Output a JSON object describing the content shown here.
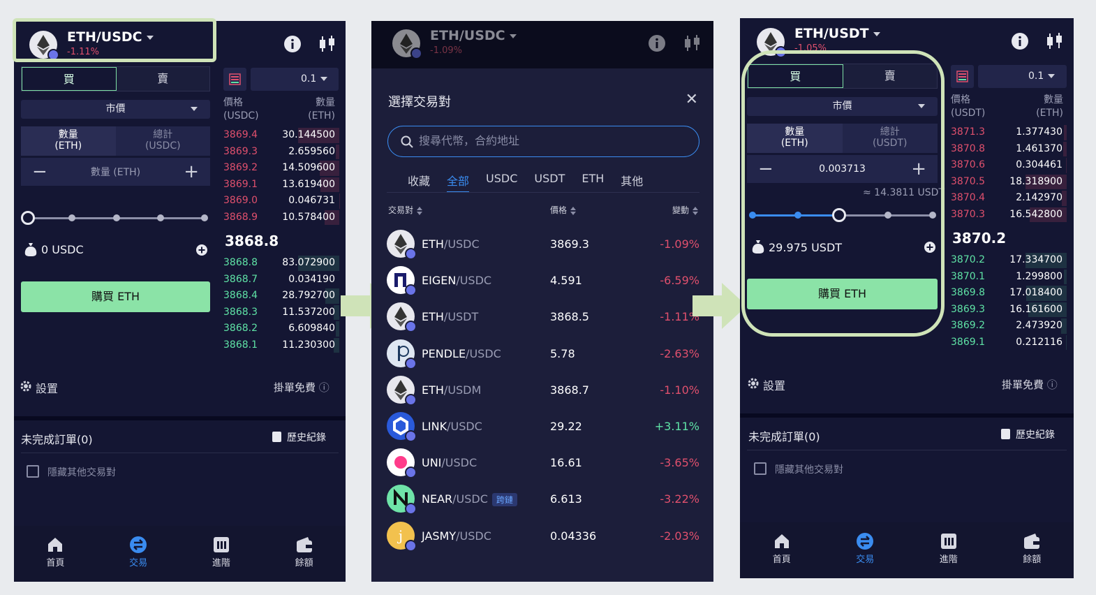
{
  "screen1": {
    "pair": "ETH/USDC",
    "change": "-1.11%",
    "tabs": [
      "買",
      "賣"
    ],
    "order_type": "市價",
    "toggle": [
      {
        "line1": "數量",
        "line2": "(ETH)"
      },
      {
        "line1": "總計",
        "line2": "(USDC)"
      }
    ],
    "qty_placeholder": "數量 (ETH)",
    "slider_fraction": 0,
    "balance": "0 USDC",
    "buy_label": "購買 ETH",
    "settings": "設置",
    "fee": "掛單免費",
    "orders_title": "未完成訂單(0)",
    "history": "歷史紀錄",
    "hide_other": "隱藏其他交易對",
    "orderbook": {
      "step": "0.1",
      "price_header": [
        "價格",
        "(USDC)"
      ],
      "amount_header": [
        "數量",
        "(ETH)"
      ],
      "asks": [
        {
          "price": "3869.4",
          "amount": "30.144500"
        },
        {
          "price": "3869.3",
          "amount": "2.659560"
        },
        {
          "price": "3869.2",
          "amount": "14.509600"
        },
        {
          "price": "3869.1",
          "amount": "13.619400"
        },
        {
          "price": "3869.0",
          "amount": "0.046731"
        },
        {
          "price": "3868.9",
          "amount": "10.578400"
        }
      ],
      "mid": "3868.8",
      "bids": [
        {
          "price": "3868.8",
          "amount": "83.072900"
        },
        {
          "price": "3868.7",
          "amount": "0.034190"
        },
        {
          "price": "3868.4",
          "amount": "28.792700"
        },
        {
          "price": "3868.3",
          "amount": "11.537200"
        },
        {
          "price": "3868.2",
          "amount": "6.609840"
        },
        {
          "price": "3868.1",
          "amount": "11.230300"
        }
      ]
    }
  },
  "screen2": {
    "pair": "ETH/USDC",
    "change": "-1.09%",
    "modal_title": "選擇交易對",
    "search_placeholder": "搜尋代幣，合約地址",
    "categories": [
      "收藏",
      "全部",
      "USDC",
      "USDT",
      "ETH",
      "其他"
    ],
    "active_category": "全部",
    "col_pair": "交易對",
    "col_price": "價格",
    "col_change": "變動",
    "rows": [
      {
        "base": "ETH",
        "quote": "/USDC",
        "price": "3869.3",
        "change": "-1.09%",
        "up": false,
        "coin_color": "#e8e8ee"
      },
      {
        "base": "EIGEN",
        "quote": "/USDC",
        "price": "4.591",
        "change": "-6.59%",
        "up": false,
        "coin_color": "#ffffff"
      },
      {
        "base": "ETH",
        "quote": "/USDT",
        "price": "3868.5",
        "change": "-1.11%",
        "up": false,
        "coin_color": "#e8e8ee"
      },
      {
        "base": "PENDLE",
        "quote": "/USDC",
        "price": "5.78",
        "change": "-2.63%",
        "up": false,
        "coin_color": "#dfe7f2"
      },
      {
        "base": "ETH",
        "quote": "/USDM",
        "price": "3868.7",
        "change": "-1.10%",
        "up": false,
        "coin_color": "#e8e8ee"
      },
      {
        "base": "LINK",
        "quote": "/USDC",
        "price": "29.22",
        "change": "+3.11%",
        "up": true,
        "coin_color": "#2a5ada"
      },
      {
        "base": "UNI",
        "quote": "/USDC",
        "price": "16.61",
        "change": "-3.65%",
        "up": false,
        "coin_color": "#ffffff"
      },
      {
        "base": "NEAR",
        "quote": "/USDC",
        "price": "6.613",
        "change": "-3.22%",
        "up": false,
        "coin_color": "#6fe3a8",
        "badge": "跨鏈"
      },
      {
        "base": "JASMY",
        "quote": "/USDC",
        "price": "0.04336",
        "change": "-2.03%",
        "up": false,
        "coin_color": "#f2c14e"
      }
    ]
  },
  "screen3": {
    "pair": "ETH/USDT",
    "change": "-1.05%",
    "tabs": [
      "買",
      "賣"
    ],
    "order_type": "市價",
    "toggle": [
      {
        "line1": "數量",
        "line2": "(ETH)"
      },
      {
        "line1": "總計",
        "line2": "(USDT)"
      }
    ],
    "qty_value": "0.003713",
    "estimate": "≈ 14.3811 USDT",
    "slider_fraction": 0.48,
    "balance": "29.975 USDT",
    "buy_label": "購買 ETH",
    "settings": "設置",
    "fee": "掛單免費",
    "orders_title": "未完成訂單(0)",
    "history": "歷史紀錄",
    "hide_other": "隱藏其他交易對",
    "orderbook": {
      "step": "0.1",
      "price_header": [
        "價格",
        "(USDT)"
      ],
      "amount_header": [
        "數量",
        "(ETH)"
      ],
      "asks": [
        {
          "price": "3871.3",
          "amount": "1.377430"
        },
        {
          "price": "3870.8",
          "amount": "1.461370"
        },
        {
          "price": "3870.6",
          "amount": "0.304461"
        },
        {
          "price": "3870.5",
          "amount": "18.318900"
        },
        {
          "price": "3870.4",
          "amount": "2.142970"
        },
        {
          "price": "3870.3",
          "amount": "16.542800"
        }
      ],
      "mid": "3870.2",
      "bids": [
        {
          "price": "3870.2",
          "amount": "17.334700"
        },
        {
          "price": "3870.1",
          "amount": "1.299800"
        },
        {
          "price": "3869.8",
          "amount": "17.018400"
        },
        {
          "price": "3869.3",
          "amount": "16.161600"
        },
        {
          "price": "3869.2",
          "amount": "2.473920"
        },
        {
          "price": "3869.1",
          "amount": "0.212116"
        }
      ]
    }
  },
  "nav": [
    {
      "label": "首頁",
      "icon": "home-icon"
    },
    {
      "label": "交易",
      "icon": "trade-icon"
    },
    {
      "label": "進階",
      "icon": "advanced-icon"
    },
    {
      "label": "餘額",
      "icon": "wallet-icon"
    }
  ],
  "colors": {
    "buy": "#8be3a7",
    "ask": "#e0506d",
    "bid": "#5fe3a6",
    "accent": "#3a8cf0",
    "highlight": "#cfe3b8"
  }
}
